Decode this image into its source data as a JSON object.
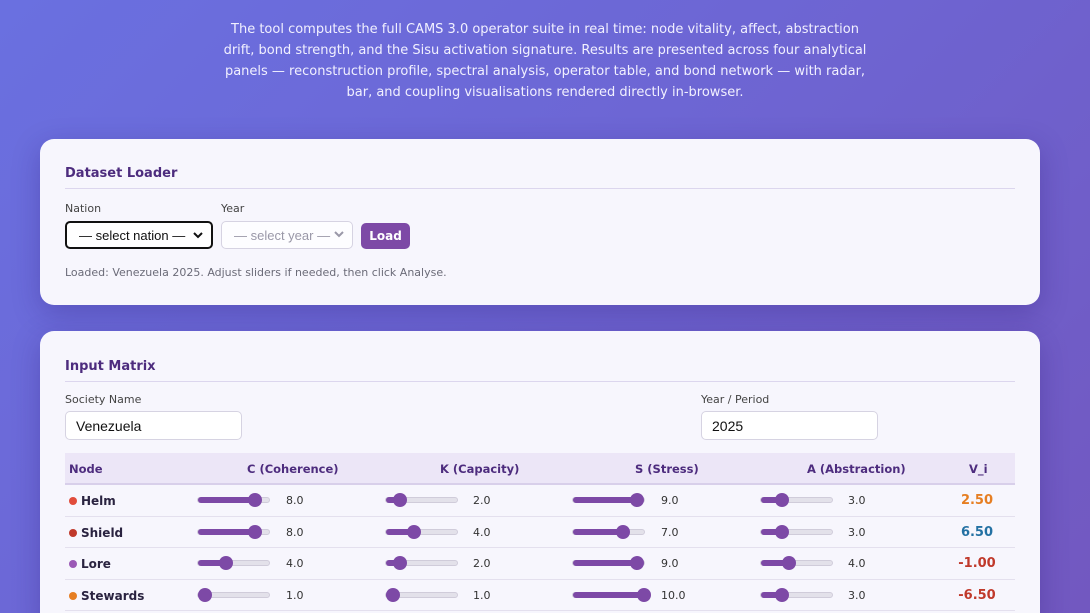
{
  "intro": "The tool computes the full CAMS 3.0 operator suite in real time: node vitality, affect, abstraction drift, bond strength, and the Sisu activation signature. Results are presented across four analytical panels — reconstruction profile, spectral analysis, operator table, and bond network — with radar, bar, and coupling visualisations rendered directly in-browser.",
  "loader": {
    "title": "Dataset Loader",
    "nation_label": "Nation",
    "nation_value": "— select nation —",
    "year_label": "Year",
    "year_value": "— select year —",
    "load_label": "Load",
    "status": "Loaded: Venezuela 2025. Adjust sliders if needed, then click Analyse."
  },
  "matrix": {
    "title": "Input Matrix",
    "society_label": "Society Name",
    "society_value": "Venezuela",
    "year_label": "Year / Period",
    "year_value": "2025",
    "columns": [
      "Node",
      "C (Coherence)",
      "K (Capacity)",
      "S (Stress)",
      "A (Abstraction)",
      "V_i"
    ],
    "slider_max": 10,
    "rows": [
      {
        "name": "Helm",
        "dot": "#e14c3b",
        "c": "8.0",
        "k": "2.0",
        "s": "9.0",
        "a": "3.0",
        "vi": "2.50",
        "vi_color": "#e67e22"
      },
      {
        "name": "Shield",
        "dot": "#c0392b",
        "c": "8.0",
        "k": "4.0",
        "s": "7.0",
        "a": "3.0",
        "vi": "6.50",
        "vi_color": "#2471a3"
      },
      {
        "name": "Lore",
        "dot": "#9b59b6",
        "c": "4.0",
        "k": "2.0",
        "s": "9.0",
        "a": "4.0",
        "vi": "-1.00",
        "vi_color": "#c0392b"
      },
      {
        "name": "Stewards",
        "dot": "#e67e22",
        "c": "1.0",
        "k": "1.0",
        "s": "10.0",
        "a": "3.0",
        "vi": "-6.50",
        "vi_color": "#c0392b"
      }
    ]
  }
}
